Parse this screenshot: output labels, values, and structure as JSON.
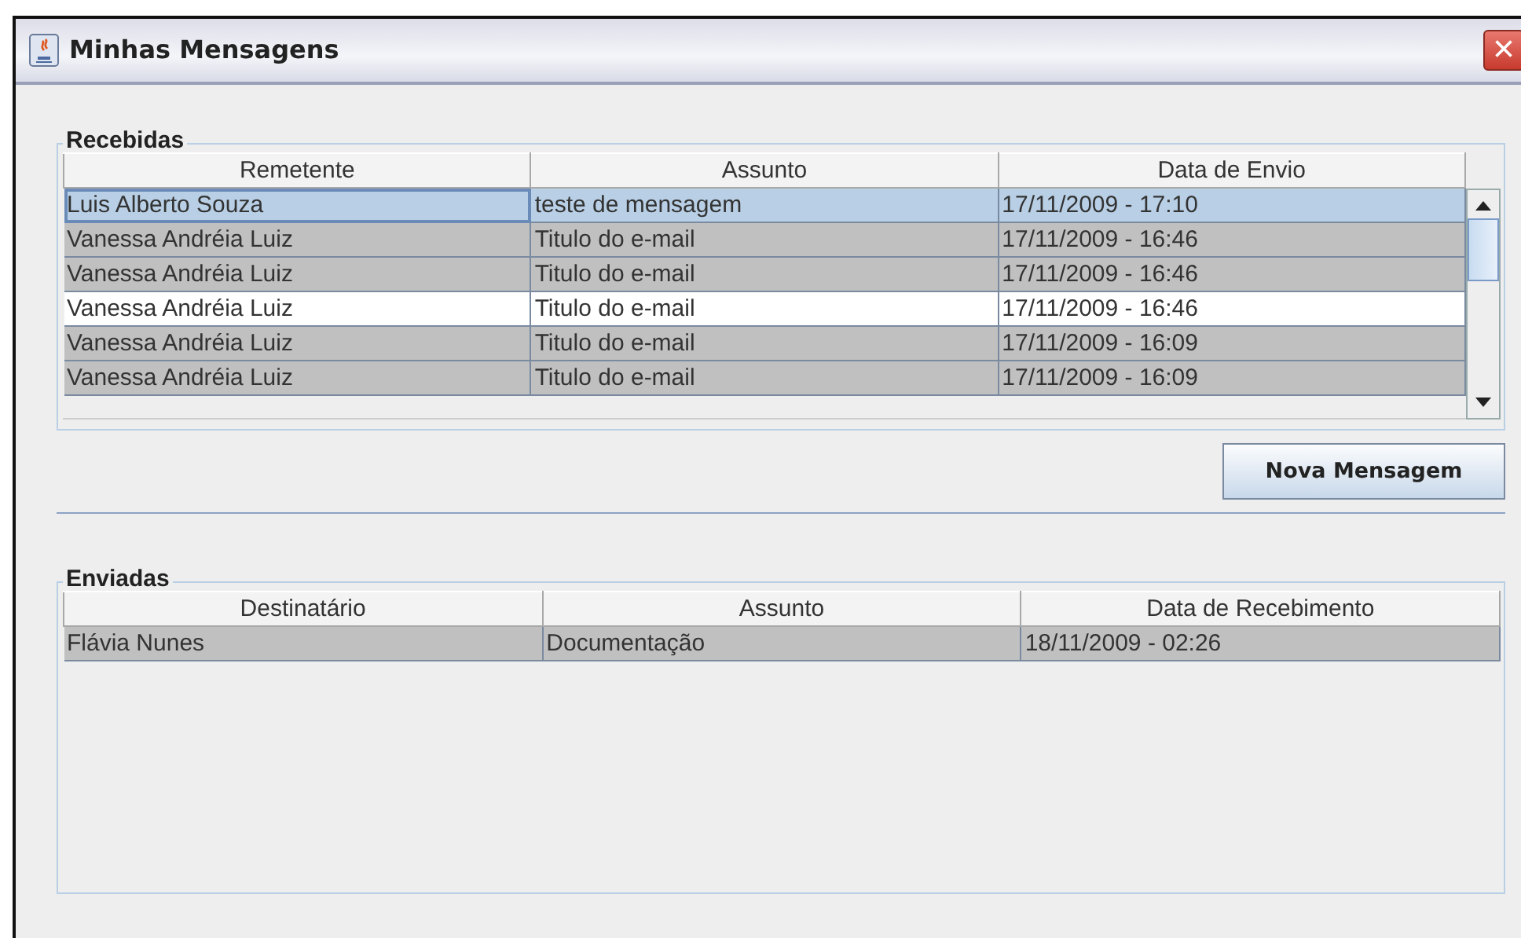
{
  "window": {
    "title": "Minhas Mensagens",
    "close": "×"
  },
  "received": {
    "legend": "Recebidas",
    "columns": [
      "Remetente",
      "Assunto",
      "Data de Envio"
    ],
    "rows": [
      {
        "cells": [
          "Luis Alberto Souza",
          "teste de mensagem",
          "17/11/2009 - 17:10"
        ],
        "selected": true
      },
      {
        "cells": [
          "Vanessa Andréia Luiz",
          "Titulo do e-mail",
          "17/11/2009 - 16:46"
        ],
        "selected": false,
        "shaded": true
      },
      {
        "cells": [
          "Vanessa Andréia Luiz",
          "Titulo do e-mail",
          "17/11/2009 - 16:46"
        ],
        "selected": false,
        "shaded": true
      },
      {
        "cells": [
          "Vanessa Andréia Luiz",
          "Titulo do e-mail",
          "17/11/2009 - 16:46"
        ],
        "selected": false,
        "shaded": false
      },
      {
        "cells": [
          "Vanessa Andréia Luiz",
          "Titulo do e-mail",
          "17/11/2009 - 16:09"
        ],
        "selected": false,
        "shaded": true
      },
      {
        "cells": [
          "Vanessa Andréia Luiz",
          "Titulo do e-mail",
          "17/11/2009 - 16:09"
        ],
        "selected": false,
        "shaded": true
      }
    ]
  },
  "new_button": "Nova Mensagem",
  "sent": {
    "legend": "Enviadas",
    "columns": [
      "Destinatário",
      "Assunto",
      "Data de Recebimento"
    ],
    "rows": [
      {
        "cells": [
          "Flávia Nunes",
          "Documentação",
          "18/11/2009 - 02:26"
        ],
        "selected": false,
        "shaded": true
      }
    ]
  }
}
